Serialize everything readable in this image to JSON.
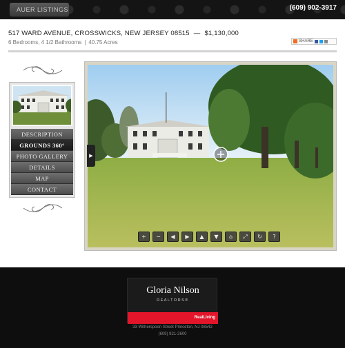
{
  "header": {
    "brand": "AUER LISTINGS",
    "phone": "(609) 902-3917"
  },
  "listing": {
    "address": "517 WARD AVENUE, CROSSWICKS, NEW JERSEY 08515",
    "dash": "—",
    "price": "$1,130,000",
    "details": "6 Bedrooms, 4 1/2 Bathrooms",
    "separator": "|",
    "acres": "40.75 Acres"
  },
  "share": {
    "label": "SHARE"
  },
  "menu": {
    "items": [
      {
        "label": "DESCRIPTION"
      },
      {
        "label": "GROUNDS 360°",
        "active": true
      },
      {
        "label": "PHOTO GALLERY"
      },
      {
        "label": "DETAILS"
      },
      {
        "label": "MAP"
      },
      {
        "label": "CONTACT"
      }
    ]
  },
  "viewer": {
    "side_arrow": "▶",
    "controls": [
      {
        "icon": "zoom-in-icon",
        "glyph": "+"
      },
      {
        "icon": "zoom-out-icon",
        "glyph": "−"
      },
      {
        "icon": "arrow-left-icon",
        "glyph": "◀"
      },
      {
        "icon": "arrow-right-icon",
        "glyph": "▶"
      },
      {
        "icon": "arrow-up-icon",
        "glyph": "▲"
      },
      {
        "icon": "arrow-down-icon",
        "glyph": "▼"
      },
      {
        "icon": "home-icon",
        "glyph": "⌂"
      },
      {
        "icon": "fullscreen-icon",
        "glyph": "⤢"
      },
      {
        "icon": "refresh-icon",
        "glyph": "↻"
      },
      {
        "icon": "help-icon",
        "glyph": "?"
      }
    ]
  },
  "footer": {
    "agent_name": "Gloria Nilson",
    "agent_sub": "REALTORS®",
    "tagline": "RealLiving",
    "address": "33 Witherspoon Street Princeton, NJ 08542",
    "phone": "(609) 921-2600"
  },
  "colors": {
    "accent_red": "#e2152b",
    "header_bg": "#141414"
  }
}
